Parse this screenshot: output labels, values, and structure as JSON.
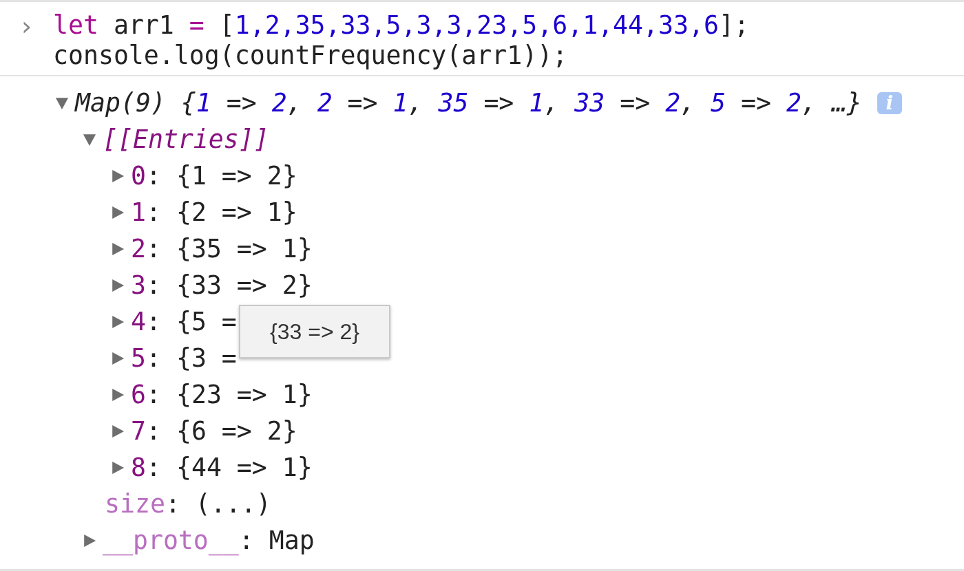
{
  "input": {
    "prompt": "›",
    "lines": [
      [
        {
          "kind": "keyword",
          "text": "let"
        },
        {
          "kind": "plain",
          "text": " arr1 "
        },
        {
          "kind": "keyword",
          "text": "="
        },
        {
          "kind": "plain",
          "text": " ["
        },
        {
          "kind": "number",
          "text": "1,2,35,33,5,3,3,23,5,6,1,44,33,6"
        },
        {
          "kind": "plain",
          "text": "];"
        }
      ],
      [
        {
          "kind": "plain",
          "text": "console.log(countFrequency(arr1));"
        }
      ]
    ]
  },
  "output": {
    "summary": {
      "expanded": true,
      "tokens": [
        {
          "kind": "plain",
          "text": "Map(9) {"
        },
        {
          "kind": "number",
          "text": "1"
        },
        {
          "kind": "plain",
          "text": " => "
        },
        {
          "kind": "number",
          "text": "2"
        },
        {
          "kind": "plain",
          "text": ", "
        },
        {
          "kind": "number",
          "text": "2"
        },
        {
          "kind": "plain",
          "text": " => "
        },
        {
          "kind": "number",
          "text": "1"
        },
        {
          "kind": "plain",
          "text": ", "
        },
        {
          "kind": "number",
          "text": "35"
        },
        {
          "kind": "plain",
          "text": " => "
        },
        {
          "kind": "number",
          "text": "1"
        },
        {
          "kind": "plain",
          "text": ", "
        },
        {
          "kind": "number",
          "text": "33"
        },
        {
          "kind": "plain",
          "text": " => "
        },
        {
          "kind": "number",
          "text": "2"
        },
        {
          "kind": "plain",
          "text": ", "
        },
        {
          "kind": "number",
          "text": "5"
        },
        {
          "kind": "plain",
          "text": " => "
        },
        {
          "kind": "number",
          "text": "2"
        },
        {
          "kind": "plain",
          "text": ", …}"
        }
      ],
      "info_badge": "i"
    },
    "entries": {
      "label": "[[Entries]]",
      "expanded": true,
      "items": [
        {
          "key": "0",
          "value": ": {1 => 2}",
          "expanded": false
        },
        {
          "key": "1",
          "value": ": {2 => 1}",
          "expanded": false
        },
        {
          "key": "2",
          "value": ": {35 => 1}",
          "expanded": false
        },
        {
          "key": "3",
          "value": ": {33 => 2}",
          "expanded": false
        },
        {
          "key": "4",
          "value": ": {5 =",
          "expanded": false
        },
        {
          "key": "5",
          "value": ": {3 =",
          "expanded": false
        },
        {
          "key": "6",
          "value": ": {23 => 1}",
          "expanded": false
        },
        {
          "key": "7",
          "value": ": {6 => 2}",
          "expanded": false
        },
        {
          "key": "8",
          "value": ": {44 => 1}",
          "expanded": false
        }
      ]
    },
    "size": {
      "key": "size",
      "value": ": (...)"
    },
    "proto": {
      "key": "__proto__",
      "value": ": Map",
      "expanded": false
    }
  },
  "tooltip": "{33 => 2}"
}
